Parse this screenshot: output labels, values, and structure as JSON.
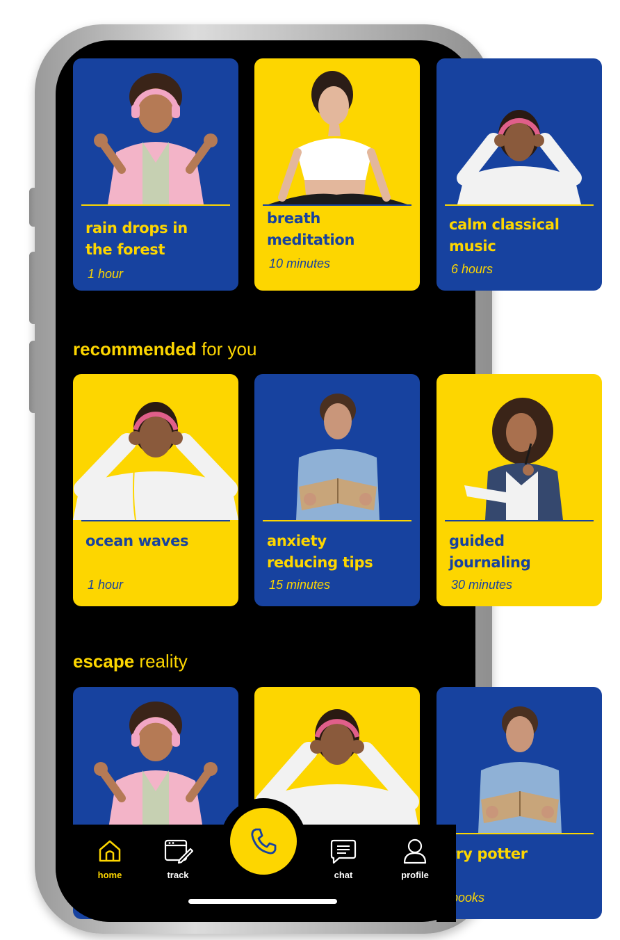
{
  "colors": {
    "blue": "#17429f",
    "yellow": "#fdd600",
    "screen": "#000000"
  },
  "top_row": [
    {
      "title_line1": "rain drops in",
      "title_line2": "the forest",
      "duration": "1 hour",
      "theme": "blue",
      "image": "woman-headphones-meditating-icon"
    },
    {
      "title_line1": "breath",
      "title_line2": "meditation",
      "duration": "10 minutes",
      "theme": "yellow",
      "image": "woman-breathing-icon"
    },
    {
      "title_line1": "calm classical",
      "title_line2": "music",
      "duration": "6 hours",
      "theme": "blue",
      "image": "man-headphones-icon"
    }
  ],
  "sections": {
    "recommended": {
      "bold": "recommended",
      "light": "for you"
    },
    "escape": {
      "bold": "escape",
      "light": "reality"
    }
  },
  "recommended_row": [
    {
      "title_line1": "ocean waves",
      "title_line2": "",
      "duration": "1 hour",
      "theme": "yellow",
      "image": "man-headphones-icon"
    },
    {
      "title_line1": "anxiety",
      "title_line2": "reducing tips",
      "duration": "15 minutes",
      "theme": "blue",
      "image": "man-reading-book-icon"
    },
    {
      "title_line1": "guided",
      "title_line2": "journaling",
      "duration": "30 minutes",
      "theme": "yellow",
      "image": "woman-journaling-icon"
    }
  ],
  "escape_row": [
    {
      "theme": "blue",
      "image": "woman-headphones-meditating-icon"
    },
    {
      "theme": "yellow",
      "image": "man-headphones-icon"
    },
    {
      "title_line1": "rry potter",
      "duration": "books",
      "theme": "blue",
      "image": "man-reading-book-icon"
    }
  ],
  "nav": {
    "home": "home",
    "track": "track",
    "chat": "chat",
    "profile": "profile",
    "active": "home"
  }
}
